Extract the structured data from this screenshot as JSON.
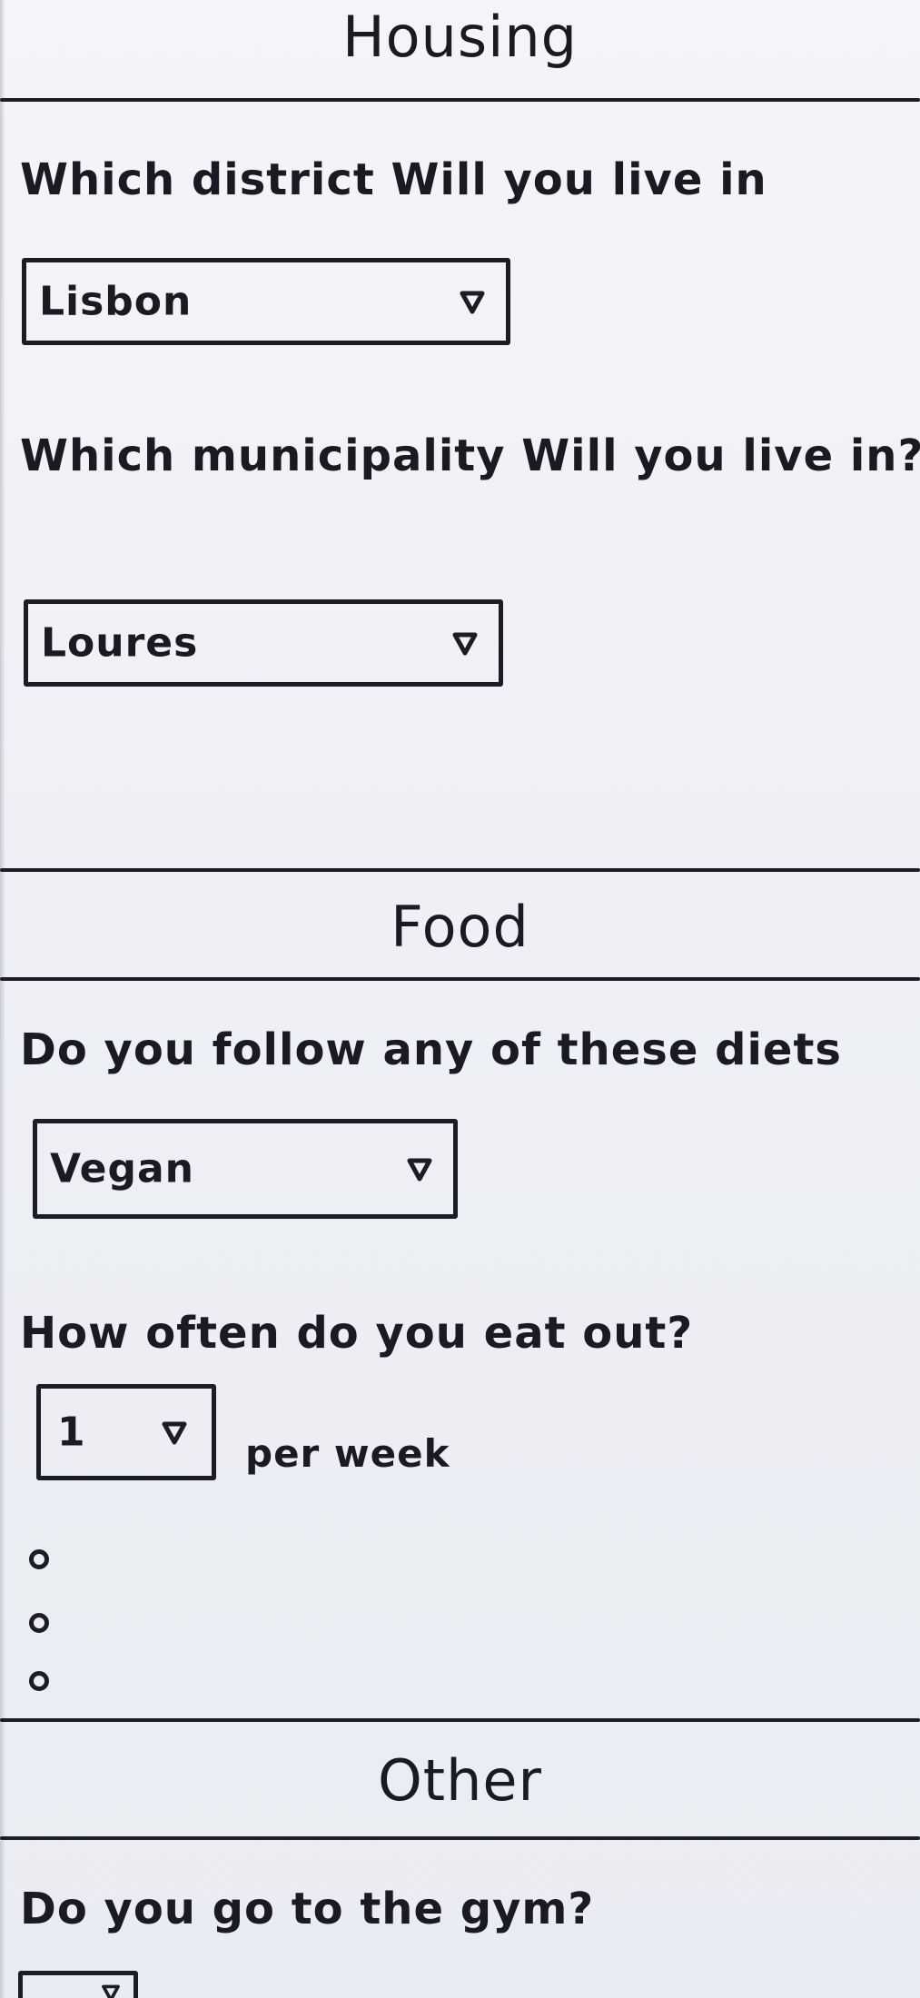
{
  "housing": {
    "title": "Housing",
    "district_question": "Which district Will you live in",
    "district_value": "Lisbon",
    "municipality_question": "Which municipality Will you live in?",
    "municipality_value": "Loures"
  },
  "food": {
    "title": "Food",
    "diet_question": "Do you follow any of these diets",
    "diet_value": "Vegan",
    "eat_out_question": "How often do you eat out?",
    "eat_out_value": "1",
    "eat_out_suffix": "per week"
  },
  "other": {
    "title": "Other",
    "gym_question": "Do you go to the gym?"
  },
  "icons": {
    "caret": "chevron-down-icon",
    "ellipsis": "vertical-dots-icon"
  },
  "colors": {
    "ink": "#1c1c24",
    "paper": "#f4f5f8"
  }
}
